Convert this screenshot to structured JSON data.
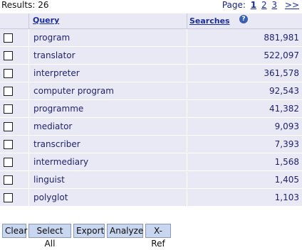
{
  "header": {
    "results_label": "Results: 26",
    "page_label": "Page:",
    "pages": [
      "1",
      "2",
      "3"
    ],
    "current_page": "1",
    "next_label": ">>"
  },
  "table": {
    "columns": {
      "query": "Query",
      "searches": "Searches",
      "help": "?"
    },
    "rows": [
      {
        "query": "program",
        "searches": "881,981"
      },
      {
        "query": "translator",
        "searches": "522,097"
      },
      {
        "query": "interpreter",
        "searches": "361,578"
      },
      {
        "query": "computer program",
        "searches": "92,543"
      },
      {
        "query": "programme",
        "searches": "41,382"
      },
      {
        "query": "mediator",
        "searches": "9,093"
      },
      {
        "query": "transcriber",
        "searches": "7,393"
      },
      {
        "query": "intermediary",
        "searches": "1,568"
      },
      {
        "query": "linguist",
        "searches": "1,405"
      },
      {
        "query": "polyglot",
        "searches": "1,103"
      }
    ]
  },
  "buttons": {
    "clear": "Clear",
    "select_all": "Select All",
    "export": "Export",
    "analyze": "Analyze",
    "xref": "X-Ref"
  }
}
